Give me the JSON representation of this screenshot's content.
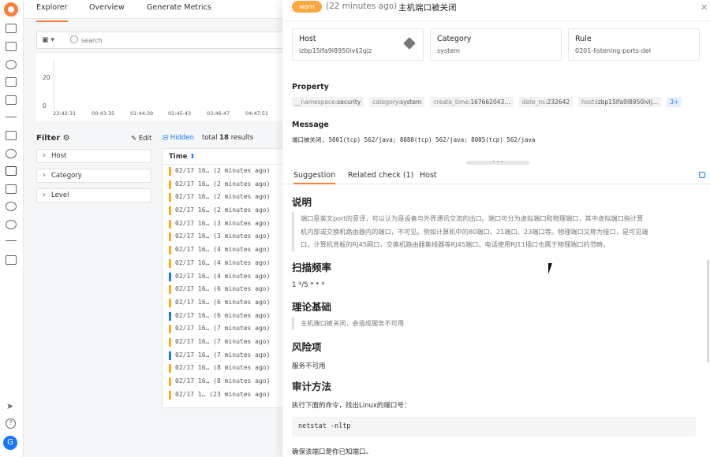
{
  "explorer": {
    "tabs": [
      "Explorer",
      "Overview",
      "Generate Metrics"
    ],
    "search_placeholder": "search",
    "histogram": {
      "y_ticks": [
        "20",
        "0"
      ],
      "x_ticks": [
        "23:42:31",
        "00:43:35",
        "01:44:39",
        "02:45:43",
        "03:46:47",
        "04:47:51"
      ]
    },
    "filter": {
      "title": "Filter",
      "edit_label": "Edit",
      "facets": [
        "Host",
        "Category",
        "Level"
      ]
    },
    "hidden_label": "Hidden",
    "total_prefix": "total",
    "total_count": "18",
    "total_suffix": "results",
    "time_header": "Time",
    "rows": [
      {
        "time": "02/17 16…",
        "ago": "(2 minutes ago)",
        "level": "warn"
      },
      {
        "time": "02/17 16…",
        "ago": "(2 minutes ago)",
        "level": "warn"
      },
      {
        "time": "02/17 16…",
        "ago": "(2 minutes ago)",
        "level": "warn"
      },
      {
        "time": "02/17 16…",
        "ago": "(2 minutes ago)",
        "level": "warn"
      },
      {
        "time": "02/17 16…",
        "ago": "(3 minutes ago)",
        "level": "warn"
      },
      {
        "time": "02/17 16…",
        "ago": "(3 minutes ago)",
        "level": "warn"
      },
      {
        "time": "02/17 16…",
        "ago": "(4 minutes ago)",
        "level": "warn"
      },
      {
        "time": "02/17 16…",
        "ago": "(4 minutes ago)",
        "level": "warn"
      },
      {
        "time": "02/17 16…",
        "ago": "(4 minutes ago)",
        "level": "info"
      },
      {
        "time": "02/17 16…",
        "ago": "(6 minutes ago)",
        "level": "warn"
      },
      {
        "time": "02/17 16…",
        "ago": "(6 minutes ago)",
        "level": "warn"
      },
      {
        "time": "02/17 16…",
        "ago": "(6 minutes ago)",
        "level": "info"
      },
      {
        "time": "02/17 16…",
        "ago": "(7 minutes ago)",
        "level": "warn"
      },
      {
        "time": "02/17 16…",
        "ago": "(7 minutes ago)",
        "level": "warn"
      },
      {
        "time": "02/17 16…",
        "ago": "(7 minutes ago)",
        "level": "info"
      },
      {
        "time": "02/17 16…",
        "ago": "(8 minutes ago)",
        "level": "warn"
      },
      {
        "time": "02/17 16…",
        "ago": "(8 minutes ago)",
        "level": "warn"
      },
      {
        "time": "02/17 1…",
        "ago": "(23 minutes ago)",
        "level": "warn"
      }
    ],
    "user_initial": "G"
  },
  "drawer": {
    "badge": "warn",
    "time_ago": "(22 minutes ago)",
    "title": "主机端口被关闭",
    "cards": [
      {
        "label": "Host",
        "value": "izbp15lfa9l8950ivlj2gjz"
      },
      {
        "label": "Category",
        "value": "system"
      },
      {
        "label": "Rule",
        "value": "0201-listening-ports-del"
      }
    ],
    "property_title": "Property",
    "properties": [
      {
        "key": "__namespace",
        "value": "security"
      },
      {
        "key": "category",
        "value": "system"
      },
      {
        "key": "create_time",
        "value": "167662043…"
      },
      {
        "key": "date_ns",
        "value": "232642"
      },
      {
        "key": "host",
        "value": "izbp15lfa9l8950ivlj…"
      }
    ],
    "more_count": "3+",
    "message_title": "Message",
    "message": "端口被关闭, 5001(tcp) 562/java; 8080(tcp) 562/java; 8005(tcp) 562/java",
    "tabs": [
      "Suggestion",
      "Related check (1)",
      "Host"
    ],
    "suggestion": {
      "h_desc": "说明",
      "desc_lines": [
        "端口是英文port的意译，可以认为是设备与外界通讯交流的出口。端口可分为虚拟端口和物理端口，其中虚拟端口指计算",
        "机内部或交换机路由器内的端口，不可见。例如计算机中的80端口、21端口、23端口等。物理端口又称为接口，是可见端",
        "口，计算机背板的RJ45网口，交换机路由器集线器等RJ45端口。电话使用RJ11插口也属于物理端口的范畴。"
      ],
      "h_freq": "扫描频率",
      "freq": "1 */5 * * *",
      "h_basis": "理论基础",
      "basis": "主机端口被关闭，会造成服务不可用",
      "h_risk": "风险项",
      "risk": "服务不可用",
      "h_audit": "审计方法",
      "audit": "执行下面的命令，找出Linux的端口号：",
      "command": "netstat -nltp",
      "confirm": "确保该端口是你已知端口。"
    }
  }
}
